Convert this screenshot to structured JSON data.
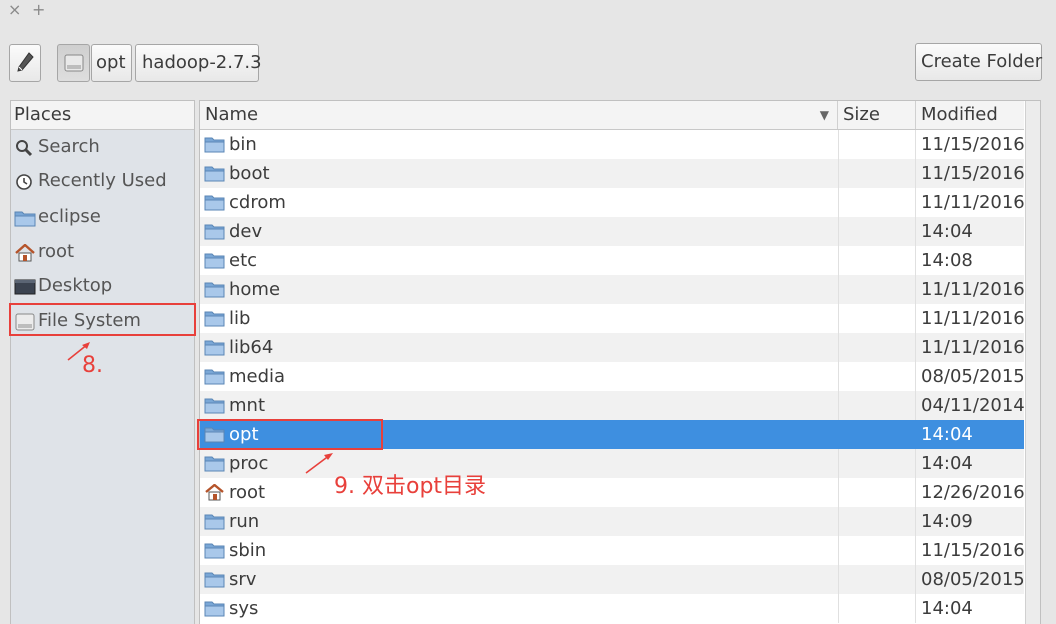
{
  "window": {
    "close_glyph": "×",
    "add_glyph": "+"
  },
  "pathbar": {
    "edit_icon": "pencil-icon",
    "root_icon": "drive-icon",
    "crumbs": [
      "opt",
      "hadoop-2.7.3"
    ],
    "create_folder_label": "Create Folder"
  },
  "places": {
    "header": "Places",
    "items": [
      {
        "label": "Search",
        "icon": "search-icon"
      },
      {
        "label": "Recently Used",
        "icon": "clock-icon"
      },
      {
        "label": "eclipse",
        "icon": "folder-icon"
      },
      {
        "label": "root",
        "icon": "home-icon"
      },
      {
        "label": "Desktop",
        "icon": "desktop-icon"
      },
      {
        "label": "File System",
        "icon": "drive-icon"
      }
    ]
  },
  "files": {
    "columns": {
      "name": "Name",
      "size": "Size",
      "modified": "Modified"
    },
    "rows": [
      {
        "name": "bin",
        "modified": "11/15/2016",
        "icon": "folder-icon"
      },
      {
        "name": "boot",
        "modified": "11/15/2016",
        "icon": "folder-icon"
      },
      {
        "name": "cdrom",
        "modified": "11/11/2016",
        "icon": "folder-icon"
      },
      {
        "name": "dev",
        "modified": "14:04",
        "icon": "folder-icon"
      },
      {
        "name": "etc",
        "modified": "14:08",
        "icon": "folder-icon"
      },
      {
        "name": "home",
        "modified": "11/11/2016",
        "icon": "folder-icon"
      },
      {
        "name": "lib",
        "modified": "11/11/2016",
        "icon": "folder-icon"
      },
      {
        "name": "lib64",
        "modified": "11/11/2016",
        "icon": "folder-icon"
      },
      {
        "name": "media",
        "modified": "08/05/2015",
        "icon": "folder-icon"
      },
      {
        "name": "mnt",
        "modified": "04/11/2014",
        "icon": "folder-icon"
      },
      {
        "name": "opt",
        "modified": "14:04",
        "icon": "folder-icon",
        "selected": true
      },
      {
        "name": "proc",
        "modified": "14:04",
        "icon": "folder-icon"
      },
      {
        "name": "root",
        "modified": "12/26/2016",
        "icon": "home-icon"
      },
      {
        "name": "run",
        "modified": "14:09",
        "icon": "folder-icon"
      },
      {
        "name": "sbin",
        "modified": "11/15/2016",
        "icon": "folder-icon"
      },
      {
        "name": "srv",
        "modified": "08/05/2015",
        "icon": "folder-icon"
      },
      {
        "name": "sys",
        "modified": "14:04",
        "icon": "folder-icon"
      }
    ]
  },
  "annotations": {
    "step8": "8.",
    "step9": "9. 双击opt目录",
    "color": "#e8403b"
  },
  "colors": {
    "selection": "#3e8fe0",
    "folder": "#7aa7d6"
  }
}
